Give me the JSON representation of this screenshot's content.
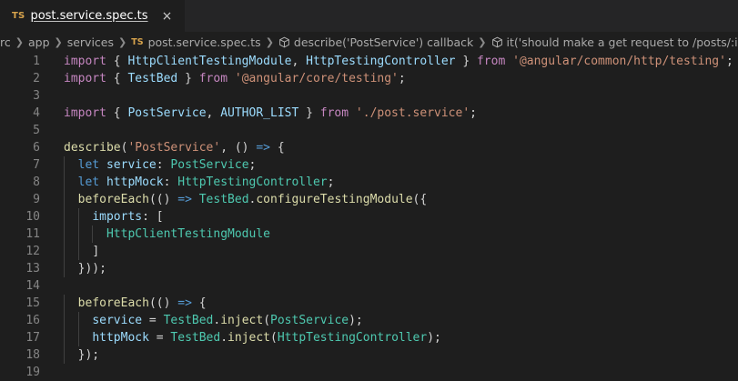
{
  "tab": {
    "badge": "TS",
    "label": "post.service.spec.ts",
    "close": "×"
  },
  "breadcrumb": {
    "items": [
      {
        "text": "rc"
      },
      {
        "text": "app"
      },
      {
        "text": "services"
      },
      {
        "text": "post.service.spec.ts",
        "badge": "TS"
      },
      {
        "text": "describe('PostService') callback",
        "icon": "cube-icon"
      },
      {
        "text": "it('should make a get request to /posts/:id when getAll",
        "icon": "cube-icon"
      }
    ]
  },
  "code_lines": [
    {
      "n": "1",
      "tokens": [
        [
          "kw2",
          "import"
        ],
        [
          "pun",
          " { "
        ],
        [
          "var",
          "HttpClientTestingModule"
        ],
        [
          "pun",
          ", "
        ],
        [
          "var",
          "HttpTestingController"
        ],
        [
          "pun",
          " } "
        ],
        [
          "kw2",
          "from"
        ],
        [
          "pun",
          " "
        ],
        [
          "str",
          "'@angular/common/http/testing'"
        ],
        [
          "pun",
          ";"
        ]
      ]
    },
    {
      "n": "2",
      "tokens": [
        [
          "kw2",
          "import"
        ],
        [
          "pun",
          " { "
        ],
        [
          "var",
          "TestBed"
        ],
        [
          "pun",
          " } "
        ],
        [
          "kw2",
          "from"
        ],
        [
          "pun",
          " "
        ],
        [
          "str",
          "'@angular/core/testing'"
        ],
        [
          "pun",
          ";"
        ]
      ]
    },
    {
      "n": "3",
      "tokens": []
    },
    {
      "n": "4",
      "tokens": [
        [
          "kw2",
          "import"
        ],
        [
          "pun",
          " { "
        ],
        [
          "var",
          "PostService"
        ],
        [
          "pun",
          ", "
        ],
        [
          "var",
          "AUTHOR_LIST"
        ],
        [
          "pun",
          " } "
        ],
        [
          "kw2",
          "from"
        ],
        [
          "pun",
          " "
        ],
        [
          "str",
          "'./post.service'"
        ],
        [
          "pun",
          ";"
        ]
      ]
    },
    {
      "n": "5",
      "tokens": []
    },
    {
      "n": "6",
      "tokens": [
        [
          "fn",
          "describe"
        ],
        [
          "pun",
          "("
        ],
        [
          "str",
          "'PostService'"
        ],
        [
          "pun",
          ", () "
        ],
        [
          "kw",
          "=>"
        ],
        [
          "pun",
          " {"
        ]
      ]
    },
    {
      "n": "7",
      "indent": 1,
      "tokens": [
        [
          "kw",
          "let"
        ],
        [
          "pun",
          " "
        ],
        [
          "var",
          "service"
        ],
        [
          "pun",
          ": "
        ],
        [
          "cls",
          "PostService"
        ],
        [
          "pun",
          ";"
        ]
      ]
    },
    {
      "n": "8",
      "indent": 1,
      "tokens": [
        [
          "kw",
          "let"
        ],
        [
          "pun",
          " "
        ],
        [
          "var",
          "httpMock"
        ],
        [
          "pun",
          ": "
        ],
        [
          "cls",
          "HttpTestingController"
        ],
        [
          "pun",
          ";"
        ]
      ]
    },
    {
      "n": "9",
      "indent": 1,
      "tokens": [
        [
          "fn",
          "beforeEach"
        ],
        [
          "pun",
          "(() "
        ],
        [
          "kw",
          "=>"
        ],
        [
          "pun",
          " "
        ],
        [
          "cls",
          "TestBed"
        ],
        [
          "pun",
          "."
        ],
        [
          "fn",
          "configureTestingModule"
        ],
        [
          "pun",
          "({"
        ]
      ]
    },
    {
      "n": "10",
      "indent": 2,
      "tokens": [
        [
          "var",
          "imports"
        ],
        [
          "pun",
          ": ["
        ]
      ]
    },
    {
      "n": "11",
      "indent": 3,
      "tokens": [
        [
          "cls",
          "HttpClientTestingModule"
        ]
      ]
    },
    {
      "n": "12",
      "indent": 2,
      "tokens": [
        [
          "pun",
          "]"
        ]
      ]
    },
    {
      "n": "13",
      "indent": 1,
      "tokens": [
        [
          "pun",
          "}));"
        ]
      ]
    },
    {
      "n": "14",
      "tokens": []
    },
    {
      "n": "15",
      "indent": 1,
      "tokens": [
        [
          "fn",
          "beforeEach"
        ],
        [
          "pun",
          "(() "
        ],
        [
          "kw",
          "=>"
        ],
        [
          "pun",
          " {"
        ]
      ]
    },
    {
      "n": "16",
      "indent": 2,
      "tokens": [
        [
          "var",
          "service"
        ],
        [
          "pun",
          " = "
        ],
        [
          "cls",
          "TestBed"
        ],
        [
          "pun",
          "."
        ],
        [
          "fn",
          "inject"
        ],
        [
          "pun",
          "("
        ],
        [
          "cls",
          "PostService"
        ],
        [
          "pun",
          ");"
        ]
      ]
    },
    {
      "n": "17",
      "indent": 2,
      "tokens": [
        [
          "var",
          "httpMock"
        ],
        [
          "pun",
          " = "
        ],
        [
          "cls",
          "TestBed"
        ],
        [
          "pun",
          "."
        ],
        [
          "fn",
          "inject"
        ],
        [
          "pun",
          "("
        ],
        [
          "cls",
          "HttpTestingController"
        ],
        [
          "pun",
          ");"
        ]
      ]
    },
    {
      "n": "18",
      "indent": 1,
      "tokens": [
        [
          "pun",
          "});"
        ]
      ]
    },
    {
      "n": "19",
      "tokens": []
    }
  ]
}
